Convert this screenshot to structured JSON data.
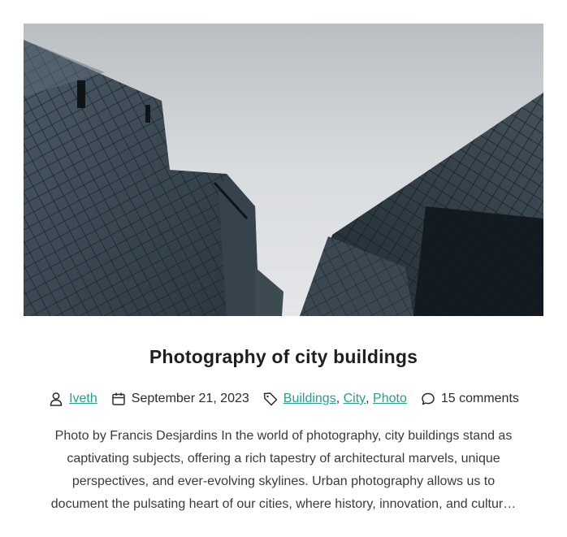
{
  "post": {
    "image_alt": "Photography of city buildings",
    "title": "Photography of city buildings",
    "author": "Iveth",
    "date": "September 21, 2023",
    "tags": [
      "Buildings",
      "City",
      "Photo"
    ],
    "comments": "15 comments",
    "excerpt": "Photo by Francis Desjardins In the world of photography, city buildings stand as captivating subjects, offering a rich tapestry of architectural marvels, unique perspectives, and ever-evolving skylines. Urban photography allows us to document the pulsating heart of our cities, where history, innovation, and cultur…"
  },
  "icons": {
    "author": "person-icon",
    "date": "calendar-icon",
    "tags": "tag-icon",
    "comments": "comment-bubble-icon"
  },
  "colors": {
    "link": "#2a9d8f",
    "title": "#1f1f1f",
    "text": "#3a3a3a"
  }
}
